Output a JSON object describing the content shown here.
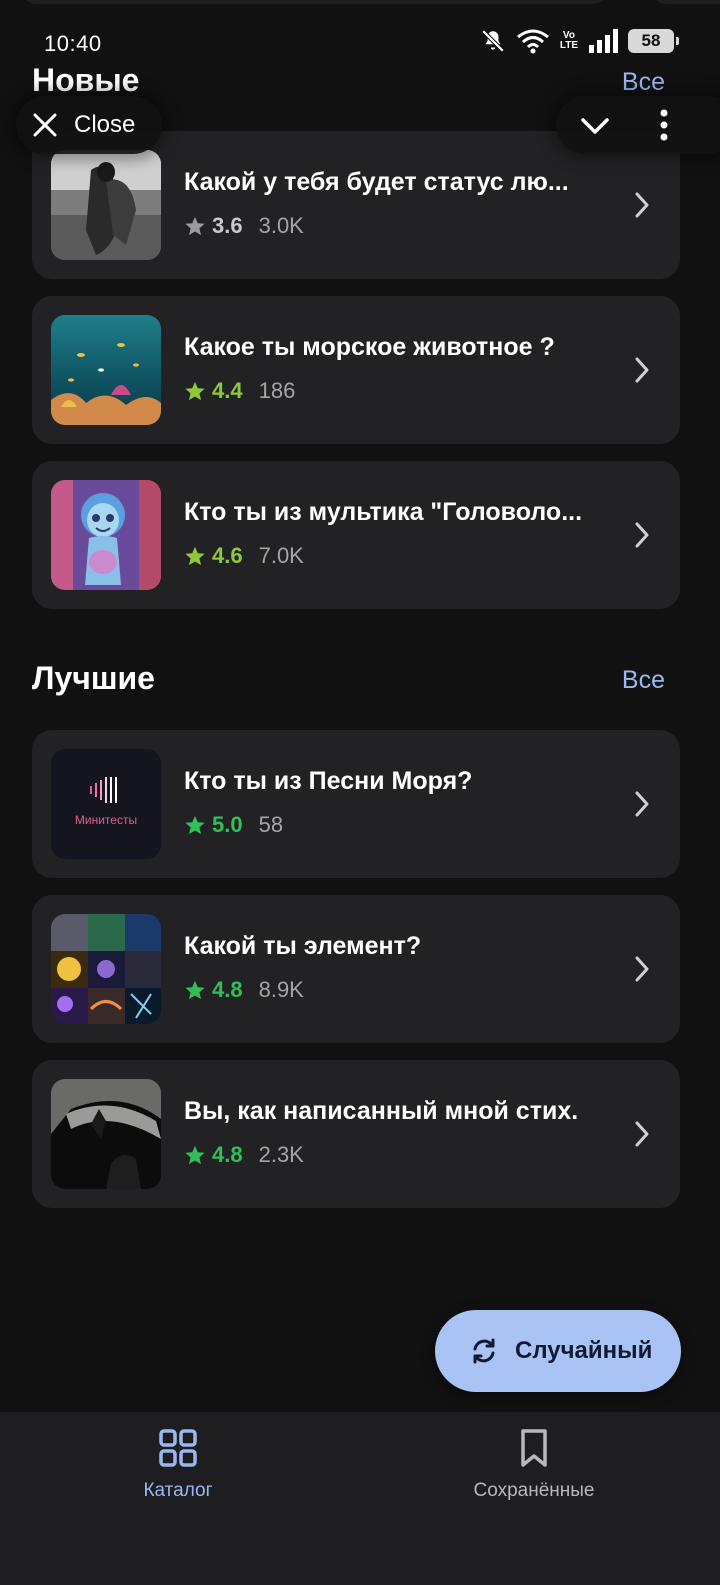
{
  "status_bar": {
    "time": "10:40",
    "lte_label_top": "Vo",
    "lte_label_bottom": "LTE",
    "battery": "58"
  },
  "overlay": {
    "close_label": "Close"
  },
  "sections": {
    "new": {
      "title": "Новые",
      "see_all": "Все",
      "items": [
        {
          "title": "Какой у тебя будет статус лю...",
          "rating": "3.6",
          "count": "3.0K",
          "star_color": "#9a9a9d",
          "rating_color": "#c8c8cb",
          "thumb": "couple-photo"
        },
        {
          "title": "Какое ты морское животное ?",
          "rating": "4.4",
          "count": "186",
          "star_color": "#8fc93a",
          "rating_color": "#8fc93a",
          "thumb": "aquarium-photo"
        },
        {
          "title": "Кто ты из мультика \"Головоло...",
          "rating": "4.6",
          "count": "7.0K",
          "star_color": "#8fc93a",
          "rating_color": "#8fc93a",
          "thumb": "cartoon-character"
        }
      ]
    },
    "best": {
      "title": "Лучшие",
      "see_all": "Все",
      "items": [
        {
          "title": "Кто ты из Песни Моря?",
          "rating": "5.0",
          "count": "58",
          "star_color": "#2fc05a",
          "rating_color": "#2fc05a",
          "thumb": "minitests-logo",
          "thumb_text": "Минитесты"
        },
        {
          "title": "Какой ты элемент?",
          "rating": "4.8",
          "count": "8.9K",
          "star_color": "#2fc05a",
          "rating_color": "#2fc05a",
          "thumb": "elements-collage"
        },
        {
          "title": "Вы, как написанный мной стих.",
          "rating": "4.8",
          "count": "2.3K",
          "star_color": "#2fc05a",
          "rating_color": "#2fc05a",
          "thumb": "dark-window-photo"
        }
      ]
    }
  },
  "fab": {
    "label": "Случайный",
    "icon": "refresh-icon",
    "color": "#a9c3f5"
  },
  "bottom_nav": {
    "items": [
      {
        "label": "Каталог",
        "icon": "grid-icon",
        "active": true,
        "color": "#9bb7f0"
      },
      {
        "label": "Сохранённые",
        "icon": "bookmark-icon",
        "active": false,
        "color": "#b8b8bb"
      }
    ]
  }
}
